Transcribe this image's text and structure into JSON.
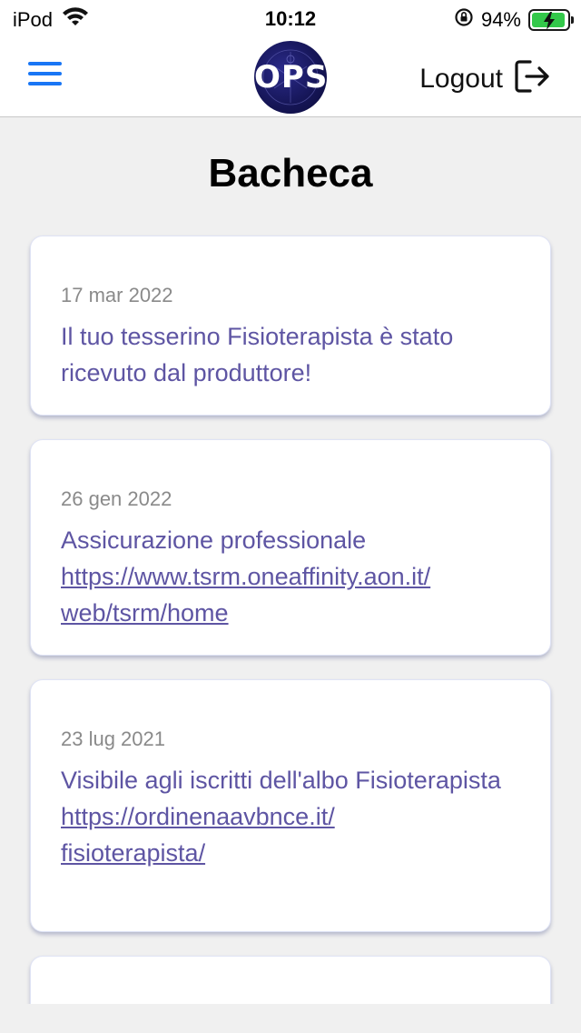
{
  "status_bar": {
    "device": "iPod",
    "time": "10:12",
    "battery_percent": "94%",
    "battery_level": 0.94
  },
  "nav": {
    "logo_text": "OPS",
    "logout_label": "Logout"
  },
  "page": {
    "title": "Bacheca"
  },
  "posts": [
    {
      "date": "17 mar 2022",
      "text": "Il tuo tesserino Fisioterapista è stato ricevuto dal produttore!",
      "link_1": "",
      "link_2": ""
    },
    {
      "date": "26 gen 2022",
      "text": "Assicurazione professionale",
      "link_1": "https://www.tsrm.oneaffinity.aon.it/",
      "link_2": "web/tsrm/home"
    },
    {
      "date": "23 lug 2021",
      "text": "Visibile agli iscritti dell'albo Fisioterapista",
      "link_1": "https://ordinenaavbnce.it/",
      "link_2": "fisioterapista/"
    }
  ],
  "colors": {
    "accent": "#1976f5",
    "post_text": "#5e55a3",
    "date_text": "#8a8a8a",
    "battery": "#33c84a"
  }
}
